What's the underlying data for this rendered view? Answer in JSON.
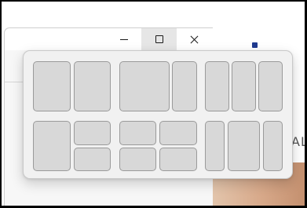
{
  "background": {
    "partial_text": "AL",
    "accent_color": "#1f3a8f"
  },
  "window": {
    "caption_buttons": [
      {
        "name": "minimize",
        "icon": "minimize-icon",
        "state": "normal"
      },
      {
        "name": "maximize",
        "icon": "maximize-icon",
        "state": "hover"
      },
      {
        "name": "close",
        "icon": "close-icon",
        "state": "normal"
      }
    ]
  },
  "snap_layouts": {
    "layouts": [
      {
        "name": "two-column-equal",
        "zones": 2
      },
      {
        "name": "two-column-wide-left",
        "zones": 2
      },
      {
        "name": "three-column-equal",
        "zones": 3
      },
      {
        "name": "left-column-right-stack",
        "zones": 3
      },
      {
        "name": "quad-grid",
        "zones": 4
      },
      {
        "name": "three-column-wide-center",
        "zones": 3
      }
    ]
  },
  "colors": {
    "flyout_background": "#f1f1f1",
    "zone_fill": "#d8d8d8",
    "zone_border": "#9a9a9a",
    "hover_background": "#e6e6e6"
  }
}
